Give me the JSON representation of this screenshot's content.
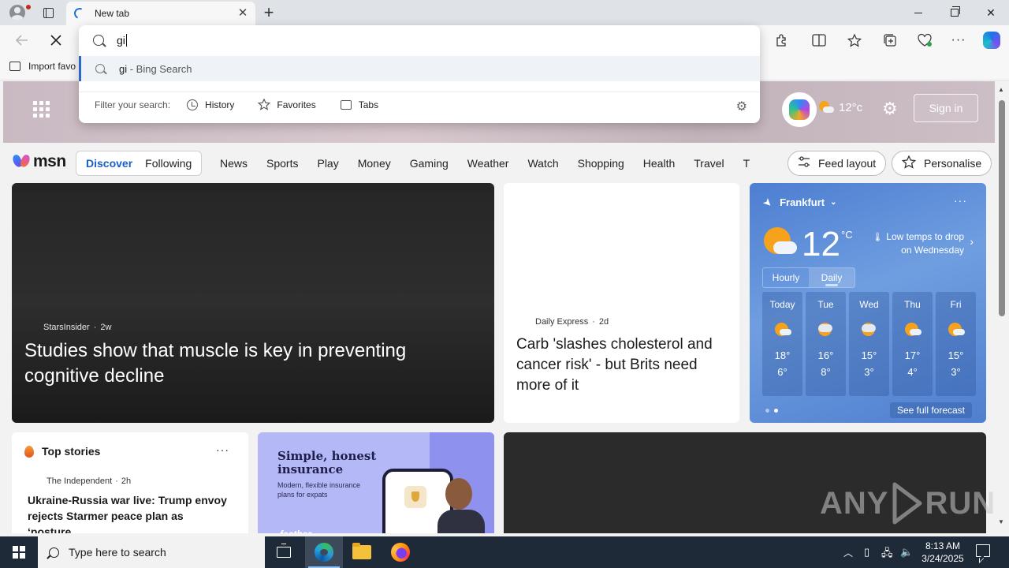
{
  "browser": {
    "tab_title": "New tab",
    "new_tab_symbol": "+",
    "tab_close_symbol": "✕",
    "favorites_import_label": "Import favo",
    "address_typed": "gi"
  },
  "omnibox": {
    "suggestion_query": "gi",
    "suggestion_suffix": " - Bing Search",
    "filter_label": "Filter your search:",
    "filters": [
      {
        "label": "History",
        "icon": "history-icon"
      },
      {
        "label": "Favorites",
        "icon": "star-icon"
      },
      {
        "label": "Tabs",
        "icon": "tabs-icon"
      }
    ]
  },
  "msn": {
    "brand": "msn",
    "banner": {
      "temp": "12°c",
      "signin_label": "Sign in"
    },
    "segments": [
      "Discover",
      "Following"
    ],
    "active_segment": "Discover",
    "nav_links": [
      "News",
      "Sports",
      "Play",
      "Money",
      "Gaming",
      "Weather",
      "Watch",
      "Shopping",
      "Health",
      "Travel",
      "Trai"
    ],
    "feed_layout_label": "Feed layout",
    "personalise_label": "Personalise",
    "hero": {
      "source": "StarsInsider",
      "age": "2w",
      "title": "Studies show that muscle is key in preventing cognitive decline"
    },
    "article": {
      "source": "Daily Express",
      "age": "2d",
      "title": "Carb 'slashes cholesterol and cancer risk' - but Brits need more of it"
    },
    "weather": {
      "location": "Frankfurt",
      "temp": "12",
      "unit": "°C",
      "alert": "Low temps to drop on Wednesday",
      "toggle": [
        "Hourly",
        "Daily"
      ],
      "active_toggle": "Daily",
      "forecast": [
        {
          "day": "Today",
          "hi": "18°",
          "lo": "6°",
          "icon": "partly-sunny-icon"
        },
        {
          "day": "Tue",
          "hi": "16°",
          "lo": "8°",
          "icon": "cloudy-sun-icon"
        },
        {
          "day": "Wed",
          "hi": "15°",
          "lo": "3°",
          "icon": "cloudy-sun-icon"
        },
        {
          "day": "Thu",
          "hi": "17°",
          "lo": "4°",
          "icon": "partly-sunny-icon"
        },
        {
          "day": "Fri",
          "hi": "15°",
          "lo": "3°",
          "icon": "partly-sunny-icon"
        }
      ],
      "see_full_label": "See full forecast"
    },
    "top_stories": {
      "header": "Top stories",
      "source": "The Independent",
      "age": "2h",
      "title": "Ukraine-Russia war live: Trump envoy rejects Starmer peace plan as ‘posture..."
    },
    "ad": {
      "title_line1": "Simple, honest",
      "title_line2": "insurance",
      "subtitle": "Modern, flexible insurance plans for expats",
      "brand": "feather"
    }
  },
  "watermark": {
    "part1": "ANY",
    "part2": "RUN"
  },
  "taskbar": {
    "search_placeholder": "Type here to search",
    "time": "8:13 AM",
    "date": "3/24/2025"
  },
  "colors": {
    "accent": "#1a5fc9",
    "taskbar": "#1f2a38",
    "weather_card": "#5a88d6"
  }
}
